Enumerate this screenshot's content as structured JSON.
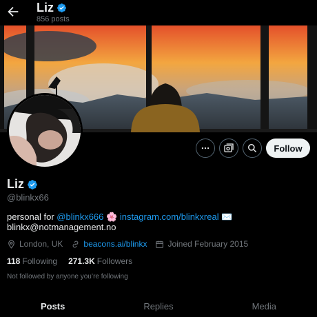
{
  "header": {
    "title": "Liz",
    "post_count": "856 posts"
  },
  "profile": {
    "name": "Liz",
    "handle": "@blinkx66",
    "bio": {
      "prefix": "personal for ",
      "mention": "@blinkx666",
      "emoji1": "🌸",
      "url": "instagram.com/blinkxreal",
      "emoji2": "✉️",
      "email": "blinkx@notmanagement.no"
    },
    "location": "London, UK",
    "website": "beacons.ai/blinkx",
    "joined": "Joined February 2015",
    "following_count": "118",
    "following_label": "Following",
    "followers_count": "271.3K",
    "followers_label": "Followers",
    "not_followed_text": "Not followed by anyone you’re following"
  },
  "actions": {
    "follow_label": "Follow"
  },
  "tabs": [
    {
      "label": "Posts",
      "active": true
    },
    {
      "label": "Replies",
      "active": false
    },
    {
      "label": "Media",
      "active": false
    }
  ],
  "colors": {
    "background": "#000000",
    "accent": "#1d9bf0",
    "text": "#e7e9ea",
    "muted": "#71767b"
  }
}
